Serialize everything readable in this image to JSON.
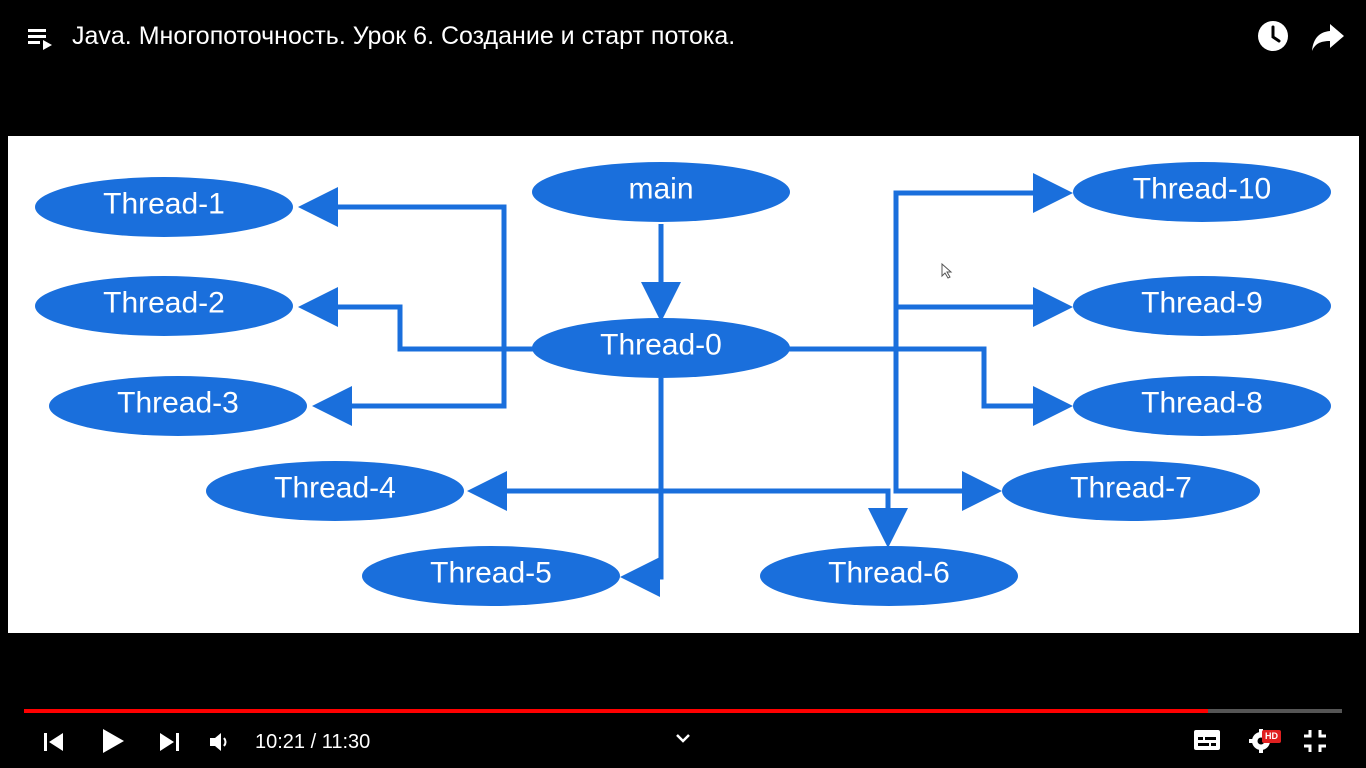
{
  "header": {
    "title": "Java. Многопоточность. Урок 6. Создание и старт потока.",
    "playlist_icon": "playlist-icon",
    "watch_later_icon": "clock-icon",
    "share_icon": "share-arrow-icon"
  },
  "diagram": {
    "node_color": "#1a6fdc",
    "edge_color": "#1a6fdc",
    "nodes": {
      "main": "main",
      "t0": "Thread-0",
      "t1": "Thread-1",
      "t2": "Thread-2",
      "t3": "Thread-3",
      "t4": "Thread-4",
      "t5": "Thread-5",
      "t6": "Thread-6",
      "t7": "Thread-7",
      "t8": "Thread-8",
      "t9": "Thread-9",
      "t10": "Thread-10"
    }
  },
  "player": {
    "progress_played_fraction": 0.898,
    "progress_loaded_fraction": 0.898,
    "current_time": "10:21",
    "duration": "11:30",
    "time_display": "10:21 / 11:30",
    "hd_badge": "HD",
    "colors": {
      "played": "#ff0000",
      "track": "#555555"
    },
    "icons": [
      "skip-previous-icon",
      "play-icon",
      "skip-next-icon",
      "volume-icon",
      "chevron-down-icon",
      "subtitles-icon",
      "settings-icon",
      "exit-fullscreen-icon"
    ]
  }
}
